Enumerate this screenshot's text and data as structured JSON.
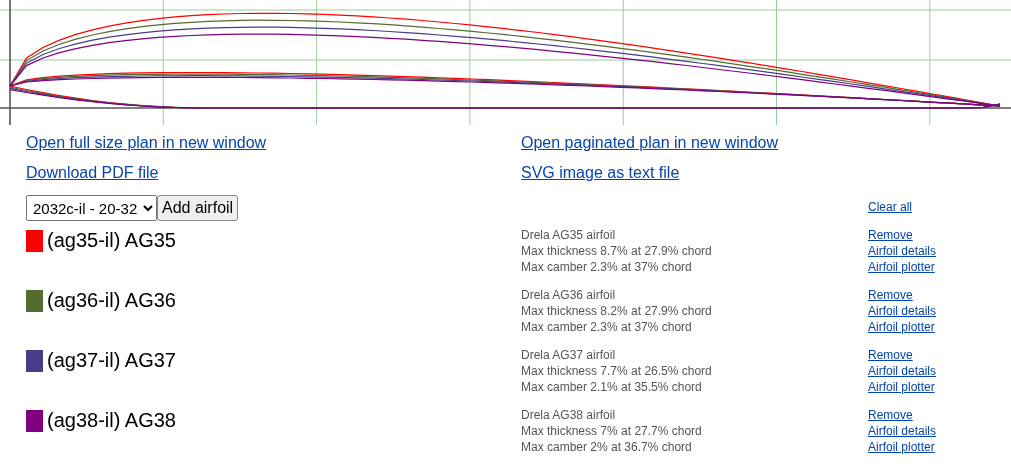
{
  "plan_links": [
    {
      "label": "Open full size plan in new window"
    },
    {
      "label": "Open paginated plan in new window"
    },
    {
      "label": "Download PDF file"
    },
    {
      "label": "SVG image as text file"
    }
  ],
  "airfoil_select": {
    "value": "2032c-il - 20-32"
  },
  "add_button": "Add airfoil",
  "clear_all": "Clear all",
  "airfoils": [
    {
      "name": "(ag35-il) AG35",
      "color": "#ff0000",
      "description": "Drela AG35 airfoil",
      "thickness": "Max thickness 8.7% at 27.9% chord",
      "camber": "Max camber 2.3% at 37% chord",
      "links": [
        "Remove",
        "Airfoil details",
        "Airfoil plotter"
      ]
    },
    {
      "name": "(ag36-il) AG36",
      "color": "#556b2f",
      "description": "Drela AG36 airfoil",
      "thickness": "Max thickness 8.2% at 27.9% chord",
      "camber": "Max camber 2.3% at 37% chord",
      "links": [
        "Remove",
        "Airfoil details",
        "Airfoil plotter"
      ]
    },
    {
      "name": "(ag37-il) AG37",
      "color": "#483d8b",
      "description": "Drela AG37 airfoil",
      "thickness": "Max thickness 7.7% at 26.5% chord",
      "camber": "Max camber 2.1% at 35.5% chord",
      "links": [
        "Remove",
        "Airfoil details",
        "Airfoil plotter"
      ]
    },
    {
      "name": "(ag38-il) AG38",
      "color": "#800080",
      "description": "Drela AG38 airfoil",
      "thickness": "Max thickness 7% at 27.7% chord",
      "camber": "Max camber 2% at 36.7% chord",
      "links": [
        "Remove",
        "Airfoil details",
        "Airfoil plotter"
      ]
    }
  ]
}
